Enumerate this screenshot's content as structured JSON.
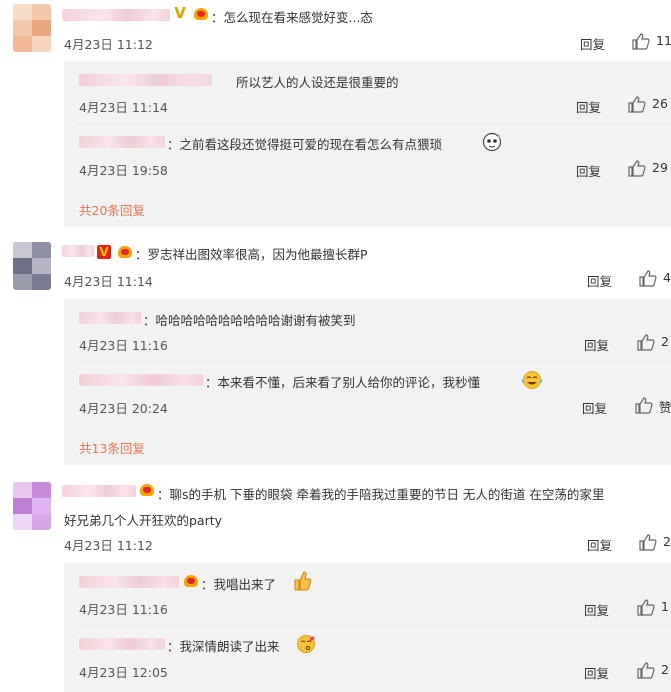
{
  "colors": {
    "accent": "#eb7350",
    "reply_bg": "#f2f2f2",
    "text": "#333333",
    "date": "#555555"
  },
  "icons": {
    "like": "thumbs-up-outline-icon",
    "badge_v_gold": "gold-v-badge-icon",
    "badge_v_red": "red-v-badge-icon",
    "medal": "fan-medal-icon"
  },
  "comments": [
    {
      "text": "：怎么现在看来感觉好变...态",
      "date": "4月23日 11:12",
      "reply_label": "回复",
      "likes": "11",
      "replies": [
        {
          "text": "所以艺人的人设还是很重要的",
          "date": "4月23日 11:14",
          "reply_label": "回复",
          "likes": "26"
        },
        {
          "text": "：之前看这段还觉得挺可爱的现在看怎么有点猥琐",
          "date": "4月23日 19:58",
          "reply_label": "回复",
          "likes": "29"
        }
      ],
      "more": "共20条回复"
    },
    {
      "text": "：罗志祥出图效率很高，因为他最擅长群P",
      "date": "4月23日 11:14",
      "reply_label": "回复",
      "likes": "4",
      "replies": [
        {
          "text": "：哈哈哈哈哈哈哈哈哈哈谢谢有被笑到",
          "date": "4月23日 11:16",
          "reply_label": "回复",
          "likes": "2"
        },
        {
          "text": "：本来看不懂，后来看了别人给你的评论，我秒懂",
          "date": "4月23日 20:24",
          "reply_label": "回复",
          "likes": "赞"
        }
      ],
      "more": "共13条回复"
    },
    {
      "text": "：聊s的手机 下垂的眼袋 牵着我的手陪我过重要的节日 无人的街道 在空荡的家里",
      "text2": "好兄弟几个人开狂欢的party",
      "date": "4月23日 11:12",
      "reply_label": "回复",
      "likes": "2",
      "replies": [
        {
          "text": "：我唱出来了",
          "date": "4月23日 11:16",
          "reply_label": "回复",
          "likes": "1"
        },
        {
          "text": "：我深情朗读了出来",
          "date": "4月23日 12:05",
          "reply_label": "回复",
          "likes": "2"
        }
      ]
    }
  ]
}
